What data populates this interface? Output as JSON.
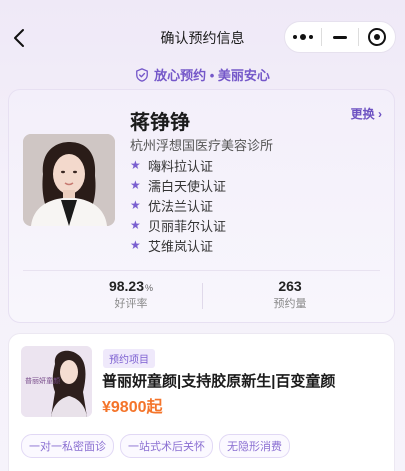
{
  "nav": {
    "title": "确认预约信息"
  },
  "tagline": {
    "text": "放心预约 • 美丽安心"
  },
  "doctor": {
    "name": "蒋铮铮",
    "change_label": "更换",
    "clinic": "杭州浮想国医疗美容诊所",
    "certifications": [
      "嗨料拉认证",
      "濡白天使认证",
      "优法兰认证",
      "贝丽菲尔认证",
      "艾维岚认证"
    ],
    "rating": {
      "value": "98.23",
      "unit": "%",
      "label": "好评率"
    },
    "appointments": {
      "value": "263",
      "label": "预约量"
    }
  },
  "project": {
    "tag": "预约项目",
    "title": "普丽妍童颜|支持胶原新生|百变童颜",
    "price": "¥9800起",
    "thumb_text": "普丽妍童颜",
    "features": [
      "一对一私密面诊",
      "一站式术后关怀",
      "无隐形消费"
    ]
  },
  "colors": {
    "accent": "#7558c9",
    "price": "#f4742a"
  }
}
